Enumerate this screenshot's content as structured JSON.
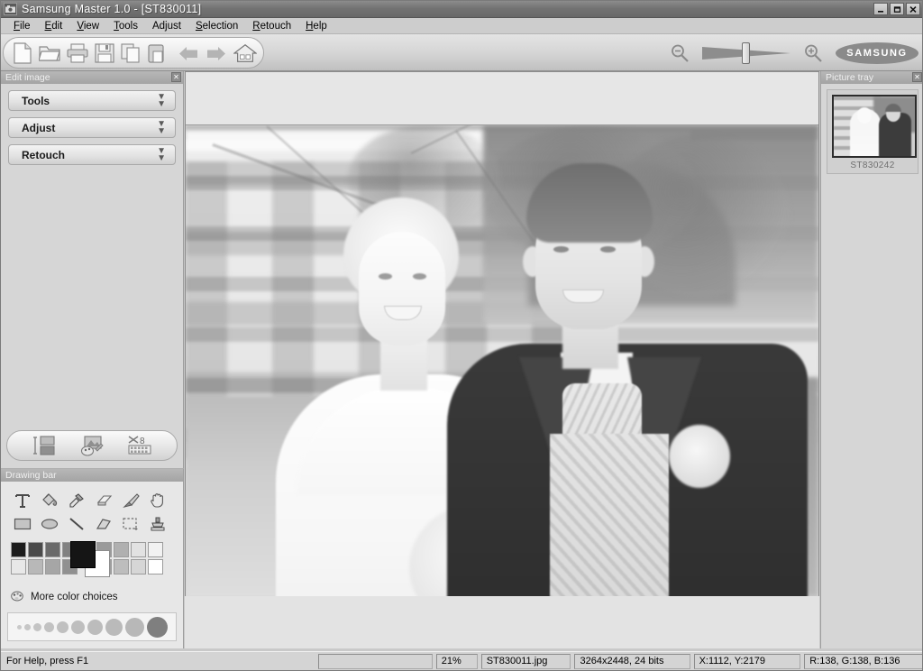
{
  "window": {
    "title": "Samsung Master 1.0 -  [ST830011]",
    "app_icon": "camera-icon",
    "minimize_label": "_",
    "restore_label": "❐",
    "close_label": "✕"
  },
  "menubar": {
    "items": [
      {
        "label": "File",
        "accel": "F"
      },
      {
        "label": "Edit",
        "accel": "E"
      },
      {
        "label": "View",
        "accel": "V"
      },
      {
        "label": "Tools",
        "accel": "T"
      },
      {
        "label": "Adjust",
        "accel": "j"
      },
      {
        "label": "Selection",
        "accel": "S"
      },
      {
        "label": "Retouch",
        "accel": "R"
      },
      {
        "label": "Help",
        "accel": "H"
      }
    ]
  },
  "toolbar": {
    "buttons": [
      {
        "name": "new-icon",
        "label": "New"
      },
      {
        "name": "open-folder-icon",
        "label": "Open"
      },
      {
        "name": "print-icon",
        "label": "Print"
      },
      {
        "name": "save-floppy-icon",
        "label": "Save"
      },
      {
        "name": "copy-icon",
        "label": "Copy"
      },
      {
        "name": "paste-icon",
        "label": "Paste"
      },
      {
        "name": "undo-arrow-icon",
        "label": "Undo"
      },
      {
        "name": "redo-arrow-icon",
        "label": "Redo"
      },
      {
        "name": "home-icon",
        "label": "Home"
      }
    ],
    "zoom_out_label": "Zoom out",
    "zoom_in_label": "Zoom in",
    "brand": "SAMSUNG"
  },
  "edit_panel": {
    "caption": "Edit image",
    "close_label": "✕",
    "sections": [
      {
        "label": "Tools"
      },
      {
        "label": "Adjust"
      },
      {
        "label": "Retouch"
      }
    ],
    "mode_buttons": [
      {
        "name": "resize-image-icon",
        "label": "Resize"
      },
      {
        "name": "paint-palette-icon",
        "label": "Paint"
      },
      {
        "name": "film-trim-icon",
        "label": "Trim"
      }
    ]
  },
  "drawing_bar": {
    "caption": "Drawing bar",
    "tools": [
      {
        "name": "text-tool-icon",
        "label": "Text"
      },
      {
        "name": "paint-bucket-icon",
        "label": "Fill"
      },
      {
        "name": "eyedropper-icon",
        "label": "Color picker"
      },
      {
        "name": "eraser-icon",
        "label": "Eraser"
      },
      {
        "name": "brush-icon",
        "label": "Brush"
      },
      {
        "name": "hand-icon",
        "label": "Pan"
      },
      {
        "name": "rectangle-icon",
        "label": "Rectangle"
      },
      {
        "name": "ellipse-icon",
        "label": "Ellipse"
      },
      {
        "name": "line-icon",
        "label": "Line"
      },
      {
        "name": "polygon-icon",
        "label": "Polygon"
      },
      {
        "name": "marquee-select-icon",
        "label": "Select"
      },
      {
        "name": "stamp-icon",
        "label": "Clone stamp"
      }
    ],
    "palette_row1": [
      "#1c1c1c",
      "#4a4a4a",
      "#6a6a6a",
      "#828282",
      "#9a9a9a",
      "#b0b0b0",
      "#e2e2e2",
      "#f2f2f2"
    ],
    "palette_row2": [
      "#e8e8e8",
      "#b8b8b8",
      "#a6a6a6",
      "#909090",
      "#9e9e9e",
      "#bdbdbd",
      "#d6d6d6",
      "#ffffff"
    ],
    "foreground_color": "#151515",
    "background_color": "#ffffff",
    "more_colors_label": "More color choices",
    "more_colors_icon": "palette-icon",
    "brush_sizes": [
      4,
      6,
      8,
      10,
      12,
      14,
      16,
      18,
      20,
      24
    ]
  },
  "picture_tray": {
    "caption": "Picture tray",
    "close_label": "✕",
    "items": [
      {
        "label": "ST830242"
      }
    ]
  },
  "canvas": {
    "image_alt": "Wedding couple photograph, greyscale"
  },
  "statusbar": {
    "help": "For Help, press F1",
    "zoom": "21%",
    "filename": "ST830011.jpg",
    "dimensions": "3264x2448, 24 bits",
    "coordinates": "X:1112, Y:2179",
    "rgb": "R:138, G:138, B:136"
  }
}
